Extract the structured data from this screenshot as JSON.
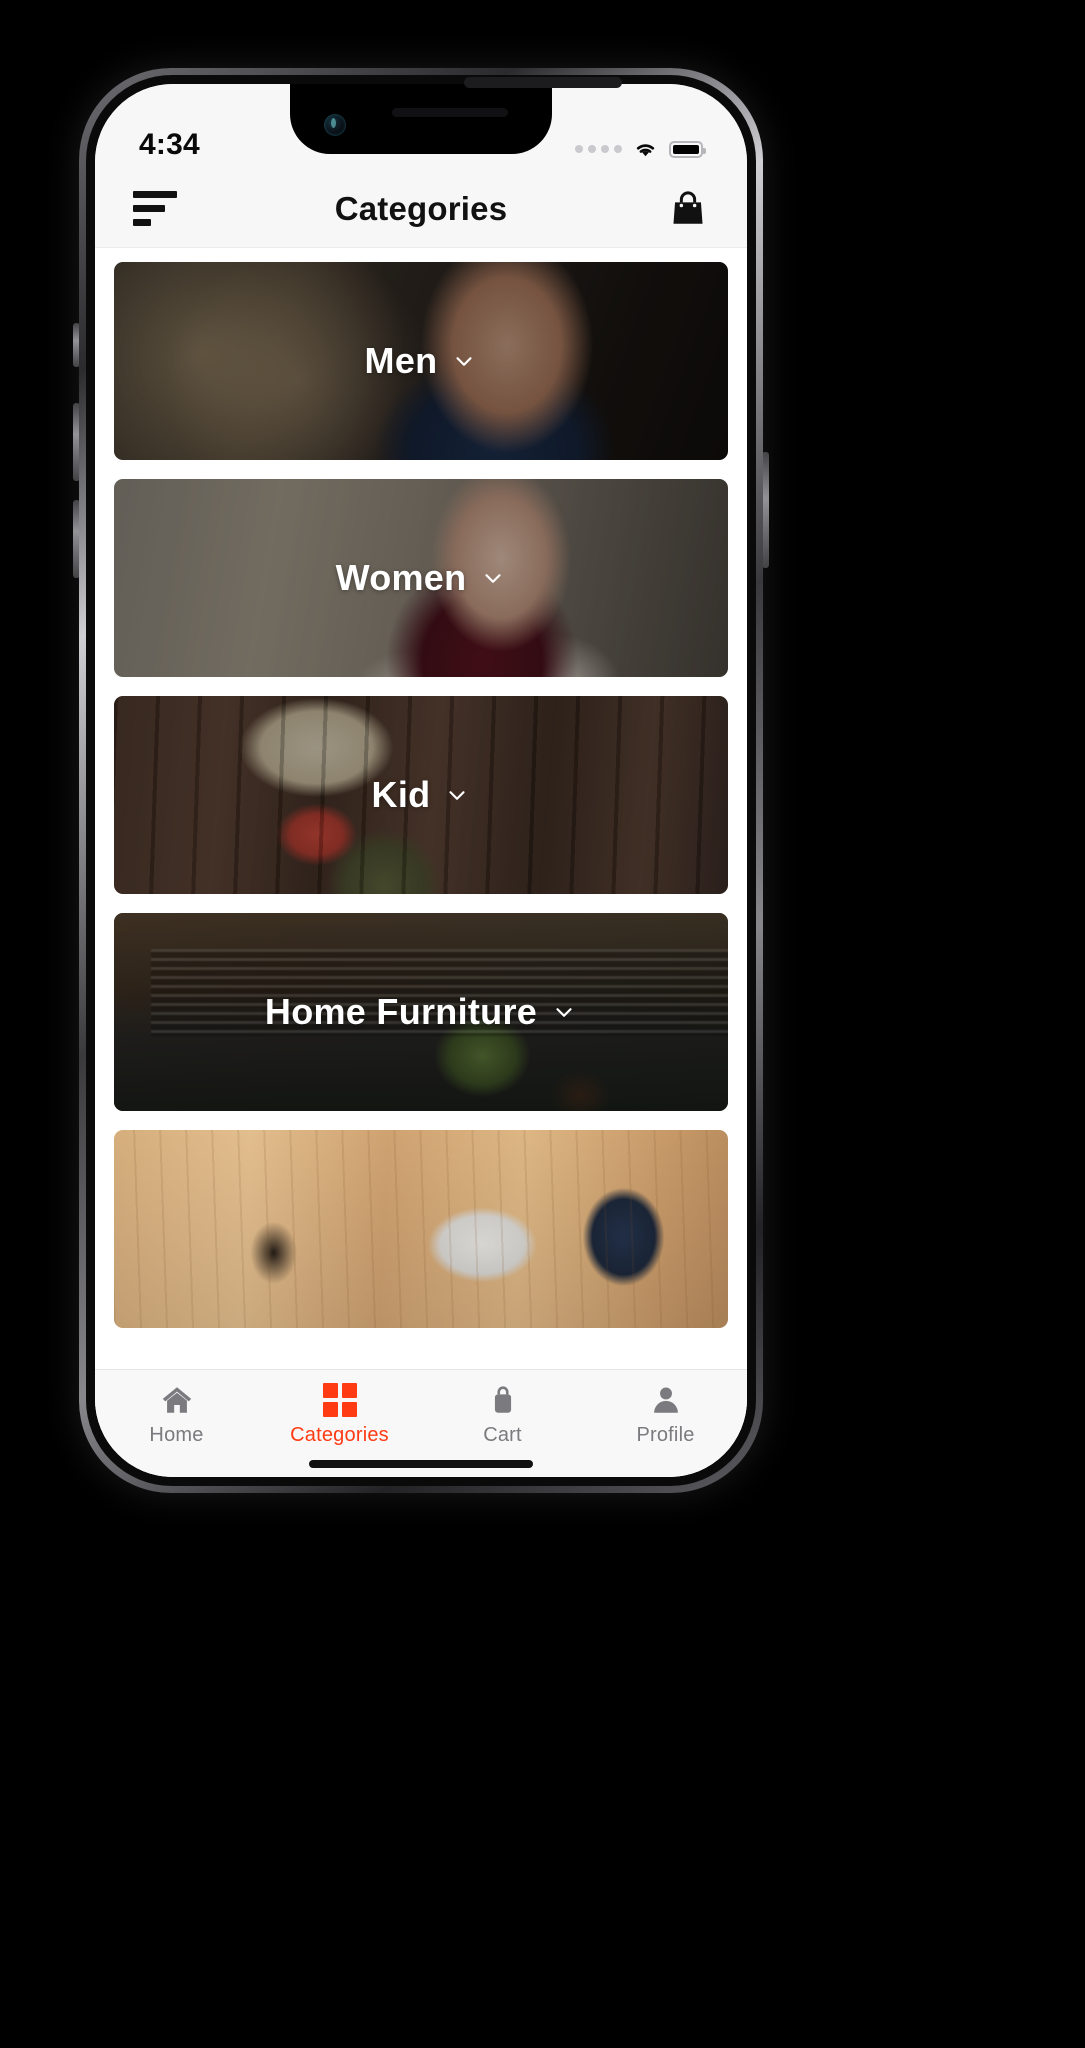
{
  "status_bar": {
    "time": "4:34",
    "cellular_icon": "signal-dots-icon",
    "wifi_icon": "wifi-icon",
    "battery_icon": "battery-full-icon"
  },
  "app_bar": {
    "menu_icon": "hamburger-menu-icon",
    "title": "Categories",
    "cart_icon": "shopping-bag-icon"
  },
  "categories": [
    {
      "label": "Men",
      "chevron": "chevron-down-icon",
      "image": "man-in-suit-photo"
    },
    {
      "label": "Women",
      "chevron": "chevron-down-icon",
      "image": "woman-shopping-photo"
    },
    {
      "label": "Kid",
      "chevron": "chevron-down-icon",
      "image": "kid-with-hat-photo"
    },
    {
      "label": "Home Furniture",
      "chevron": "chevron-down-icon",
      "image": "outdoor-bench-plant-photo"
    },
    {
      "label": "",
      "chevron": "chevron-down-icon",
      "image": "desk-accessories-photo"
    }
  ],
  "bottom_nav": {
    "active_color": "#ff3b14",
    "inactive_color": "#7b7b7f",
    "items": [
      {
        "label": "Home",
        "icon": "home-icon",
        "active": false
      },
      {
        "label": "Categories",
        "icon": "grid-icon",
        "active": true
      },
      {
        "label": "Cart",
        "icon": "shopping-bag-icon",
        "active": false
      },
      {
        "label": "Profile",
        "icon": "person-icon",
        "active": false
      }
    ]
  }
}
